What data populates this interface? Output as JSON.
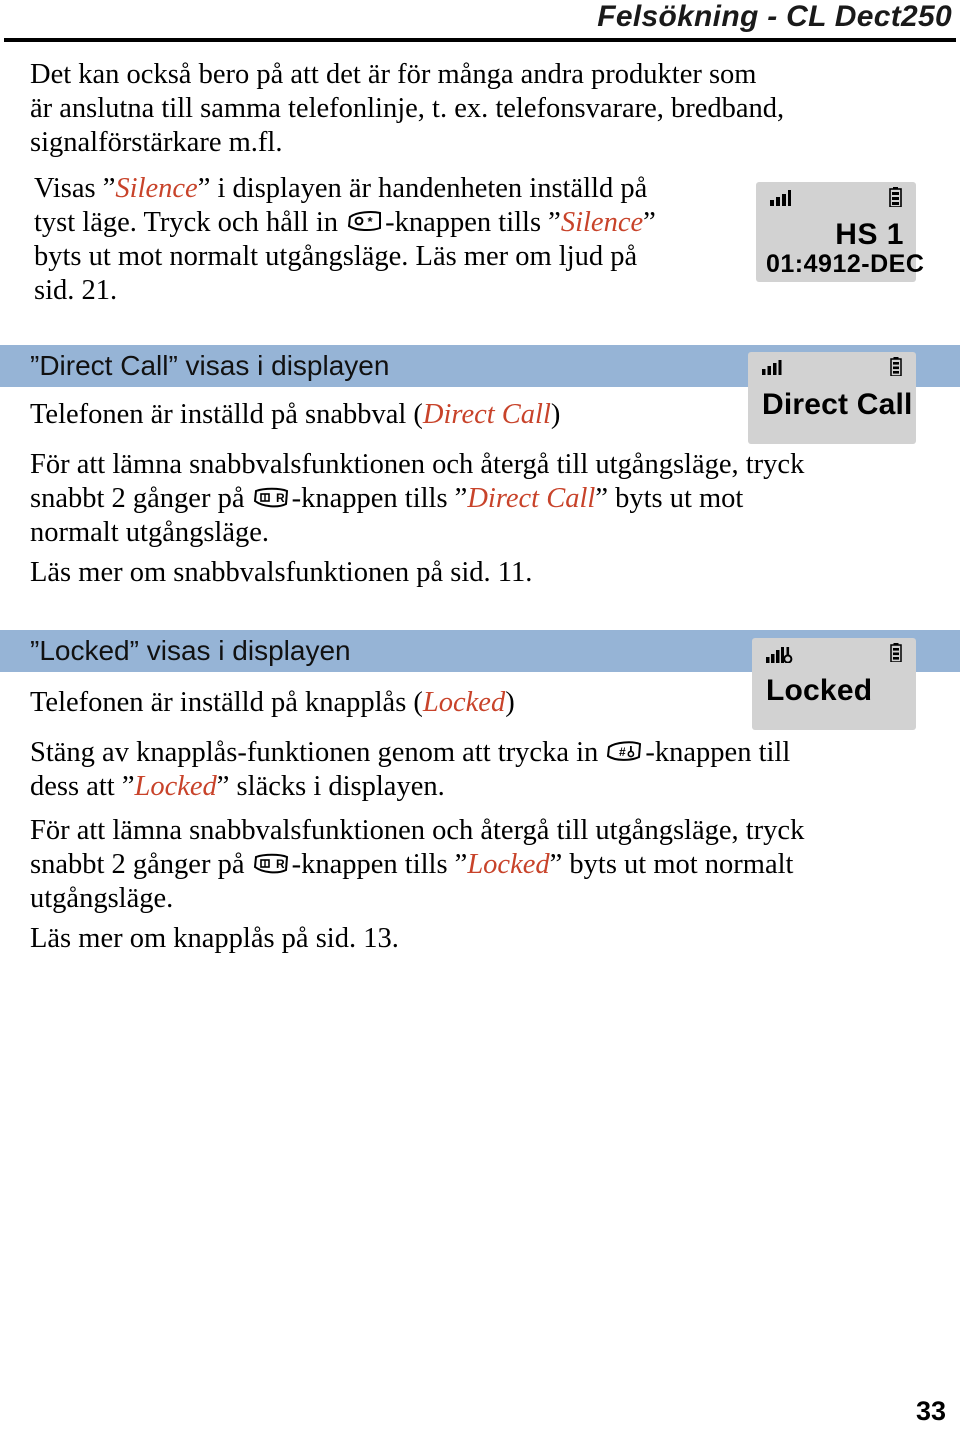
{
  "header": {
    "title": "Felsökning - CL Dect250"
  },
  "intro": {
    "paragraph1_line1": "Det kan också bero på att det är för många andra produkter som",
    "paragraph1_line2": "är anslutna till samma telefonlinje, t. ex. telefonsvarare, bredband,",
    "paragraph1_line3": "signalförstärkare m.fl.",
    "paragraph2": {
      "seg1": "Visas ”",
      "em1": "Silence",
      "seg2": "” i displayen är handenheten inställd på",
      "seg3": "tyst läge. Tryck och håll in ",
      "icon1": "star-key-icon",
      "seg4": "-knappen tills ”",
      "em2": "Silence",
      "seg5": "”",
      "seg6": "byts ut mot normalt utgångsläge. Läs mer om ljud på",
      "seg7": "sid. 21."
    }
  },
  "display_idle": {
    "signal_icon": "signal-bars-icon",
    "battery_icon": "battery-icon",
    "handset_label": "HS 1",
    "time": "01:49",
    "date": "12-DEC"
  },
  "section_direct_call": {
    "band_label": "”Direct Call” visas i displayen",
    "paragraph1": {
      "seg1": "Telefonen är inställd på snabbval (",
      "em1": "Direct Call",
      "seg2": ")"
    },
    "paragraph2": {
      "seg1": "För att lämna snabbvalsfunktionen och återgå till utgångsläge, tryck",
      "seg2": "snabbt 2 gånger på ",
      "icon1": "r-key-icon",
      "seg3": "-knappen tills ”",
      "em1": "Direct Call",
      "seg4": "” byts ut mot",
      "seg5": "normalt utgångsläge."
    },
    "paragraph3": "Läs mer om snabbvalsfunktionen på sid. 11.",
    "display": {
      "signal_icon": "signal-bars-icon",
      "battery_icon": "battery-icon",
      "text": "Direct Call"
    }
  },
  "section_locked": {
    "band_label": "”Locked” visas i displayen",
    "paragraph1": {
      "seg1": "Telefonen är inställd på knapplås (",
      "em1": "Locked",
      "seg2": ")"
    },
    "paragraph2": {
      "seg1": "Stäng av knapplås-funktionen genom att trycka in ",
      "icon1": "hash-lock-key-icon",
      "seg2": "-knappen till",
      "seg3": "dess att ”",
      "em1": "Locked",
      "seg4": "” släcks i displayen."
    },
    "paragraph3": {
      "seg1": "För att lämna snabbvalsfunktionen och återgå till utgångsläge, tryck",
      "seg2": "snabbt 2 gånger på ",
      "icon1": "r-key-icon",
      "seg3": "-knappen tills ”",
      "em1": "Locked",
      "seg4": "” byts ut mot normalt",
      "seg5": "utgångsläge."
    },
    "paragraph4": "Läs mer om knapplås på sid. 13.",
    "display": {
      "signal_icon": "signal-bars-keylock-icon",
      "battery_icon": "battery-icon",
      "text": "Locked"
    }
  },
  "footer": {
    "page_number": "33"
  },
  "colors": {
    "band_blue": "#96b4d6",
    "lcd_grey": "#d2d2d2",
    "emphasis_red": "#c8432a"
  }
}
